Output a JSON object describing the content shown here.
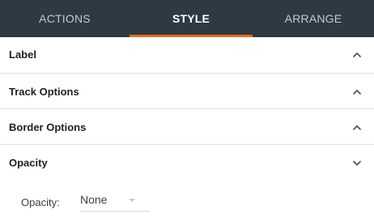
{
  "tabs": [
    {
      "label": "ACTIONS",
      "active": false
    },
    {
      "label": "STYLE",
      "active": true
    },
    {
      "label": "ARRANGE",
      "active": false
    }
  ],
  "accent_color": "#f26a1b",
  "tabbar_color": "#2d3a43",
  "sections": [
    {
      "label": "Label",
      "icon": "chevron-up-icon",
      "expanded": false
    },
    {
      "label": "Track Options",
      "icon": "chevron-up-icon",
      "expanded": false
    },
    {
      "label": "Border Options",
      "icon": "chevron-up-icon",
      "expanded": false
    },
    {
      "label": "Opacity",
      "icon": "chevron-down-icon",
      "expanded": true
    }
  ],
  "opacity": {
    "label": "Opacity:",
    "selected": "None"
  }
}
